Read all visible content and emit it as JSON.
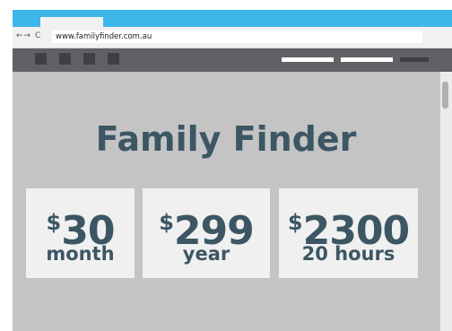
{
  "browser": {
    "nav_glyphs": "←→ C",
    "url": "www.familyfinder.com.au"
  },
  "page": {
    "title": "Family Finder"
  },
  "pricing": [
    {
      "currency": "$",
      "amount": "30",
      "period": "month"
    },
    {
      "currency": "$",
      "amount": "299",
      "period": "year"
    },
    {
      "currency": "$",
      "amount": "2300",
      "period": "20 hours"
    }
  ],
  "colors": {
    "tab_bar": "#3fb6e8",
    "nav_bar": "#5f6164",
    "page_background": "#c4c4c4",
    "card_background": "#f0f0f0",
    "text": "#3d5664"
  }
}
